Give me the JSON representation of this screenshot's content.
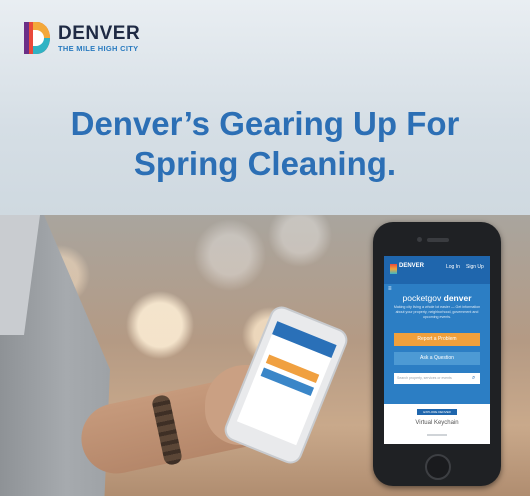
{
  "logo": {
    "name": "DENVER",
    "tagline": "THE MILE HIGH CITY"
  },
  "headline": {
    "line1": "Denver’s Gearing Up For",
    "line2": "Spring Cleaning."
  },
  "app_screen": {
    "brand": "DENVER",
    "nav": [
      "Log In",
      "Sign Up"
    ],
    "menu_icon": "hamburger-icon",
    "title_prefix": "pocketgov",
    "title_bold": "denver",
    "description": "Making city living a whole lot easier — Get information about your property, neighborhood, government and upcoming events.",
    "button_report": "Report a Problem",
    "button_ask": "Ask a Question",
    "search_placeholder": "Search property, services or events",
    "small_button": "EXPLORE DENVER",
    "section_title": "Virtual Keychain"
  },
  "colors": {
    "headline": "#2c6fb5",
    "brand_dark": "#1f2a44",
    "app_blue": "#1f66ad",
    "orange": "#f0a03c"
  }
}
